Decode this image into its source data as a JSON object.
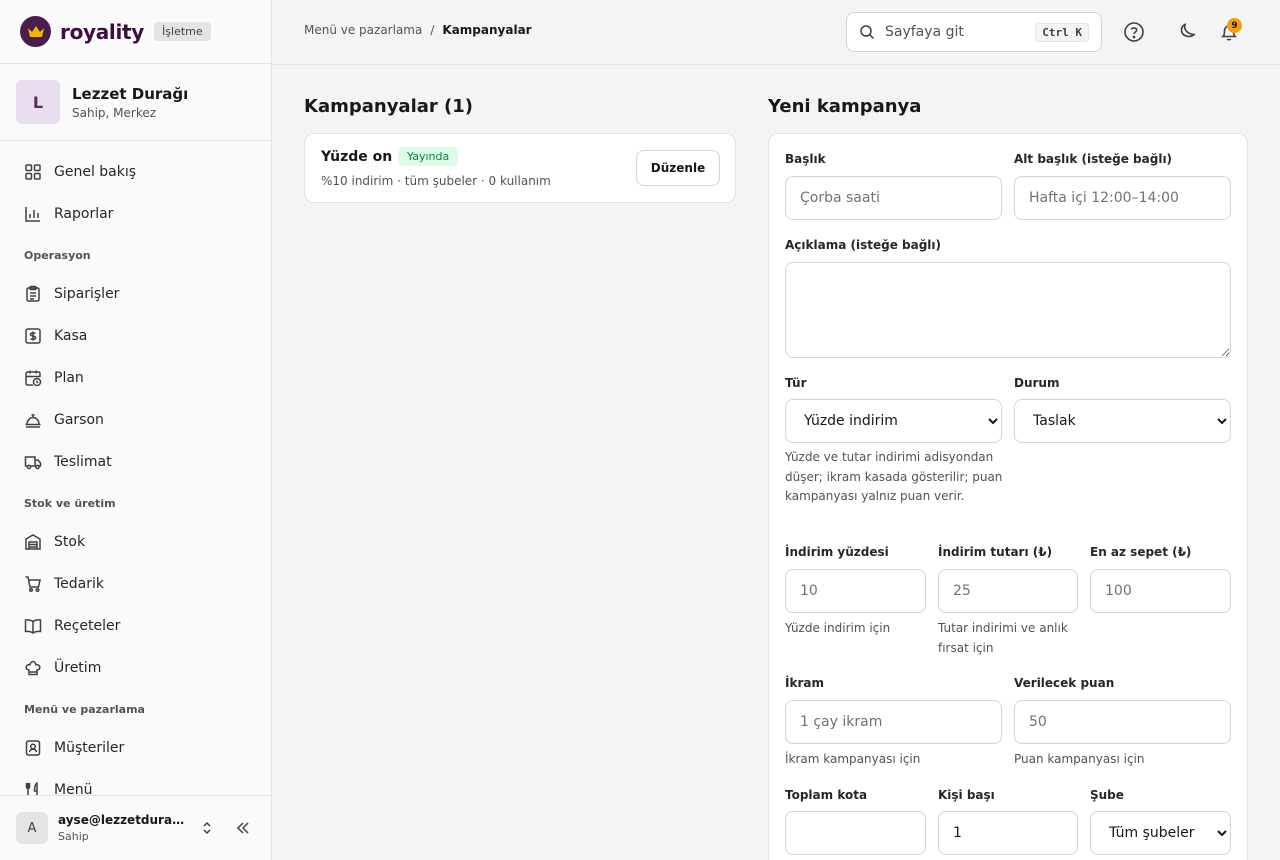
{
  "brand": {
    "name": "royality",
    "badge": "İşletme"
  },
  "org": {
    "initial": "L",
    "name": "Lezzet Durağı",
    "role": "Sahip, Merkez"
  },
  "nav": {
    "top": [
      {
        "label": "Genel bakış",
        "icon": "grid-icon"
      },
      {
        "label": "Raporlar",
        "icon": "bar-chart-icon"
      }
    ],
    "sections": [
      {
        "title": "Operasyon",
        "items": [
          {
            "label": "Siparişler",
            "icon": "clipboard-icon"
          },
          {
            "label": "Kasa",
            "icon": "cash-icon"
          },
          {
            "label": "Plan",
            "icon": "calendar-clock-icon"
          },
          {
            "label": "Garson",
            "icon": "cloche-icon"
          },
          {
            "label": "Teslimat",
            "icon": "truck-icon"
          }
        ]
      },
      {
        "title": "Stok ve üretim",
        "items": [
          {
            "label": "Stok",
            "icon": "warehouse-icon"
          },
          {
            "label": "Tedarik",
            "icon": "cart-icon"
          },
          {
            "label": "Reçeteler",
            "icon": "book-icon"
          },
          {
            "label": "Üretim",
            "icon": "chef-hat-icon"
          }
        ]
      },
      {
        "title": "Menü ve pazarlama",
        "items": [
          {
            "label": "Müşteriler",
            "icon": "contact-icon"
          },
          {
            "label": "Menü",
            "icon": "menu-icon"
          }
        ]
      }
    ]
  },
  "user": {
    "initial": "A",
    "email": "ayse@lezzetduragi.com",
    "role": "Sahip"
  },
  "topbar": {
    "breadcrumb_parent": "Menü ve pazarlama",
    "breadcrumb_sep": "/",
    "breadcrumb_current": "Kampanyalar",
    "search_placeholder": "Sayfaya git",
    "search_kbd": "Ctrl K",
    "notification_count": "9"
  },
  "campaigns": {
    "heading": "Kampanyalar (1)",
    "items": [
      {
        "title": "Yüzde on",
        "status": "Yayında",
        "meta": "%10 indirim · tüm şubeler · 0 kullanım",
        "edit_label": "Düzenle"
      }
    ]
  },
  "form": {
    "heading": "Yeni kampanya",
    "title_label": "Başlık",
    "title_placeholder": "Çorba saati",
    "subtitle_label": "Alt başlık (isteğe bağlı)",
    "subtitle_placeholder": "Hafta içi 12:00–14:00",
    "description_label": "Açıklama (isteğe bağlı)",
    "type_label": "Tür",
    "type_value": "Yüzde indirim",
    "type_hint": "Yüzde ve tutar indirimi adisyondan düşer; ikram kasada gösterilir; puan kampanyası yalnız puan verir.",
    "status_label": "Durum",
    "status_value": "Taslak",
    "percent_label": "İndirim yüzdesi",
    "percent_placeholder": "10",
    "percent_hint": "Yüzde indirim için",
    "amount_label": "İndirim tutarı (₺)",
    "amount_placeholder": "25",
    "amount_hint": "Tutar indirimi ve anlık fırsat için",
    "min_basket_label": "En az sepet (₺)",
    "min_basket_placeholder": "100",
    "gift_label": "İkram",
    "gift_placeholder": "1 çay ikram",
    "gift_hint": "İkram kampanyası için",
    "points_label": "Verilecek puan",
    "points_placeholder": "50",
    "points_hint": "Puan kampanyası için",
    "quota_label": "Toplam kota",
    "quota_value": "",
    "per_person_label": "Kişi başı",
    "per_person_value": "1",
    "branch_label": "Şube",
    "branch_value": "Tüm şubeler"
  }
}
